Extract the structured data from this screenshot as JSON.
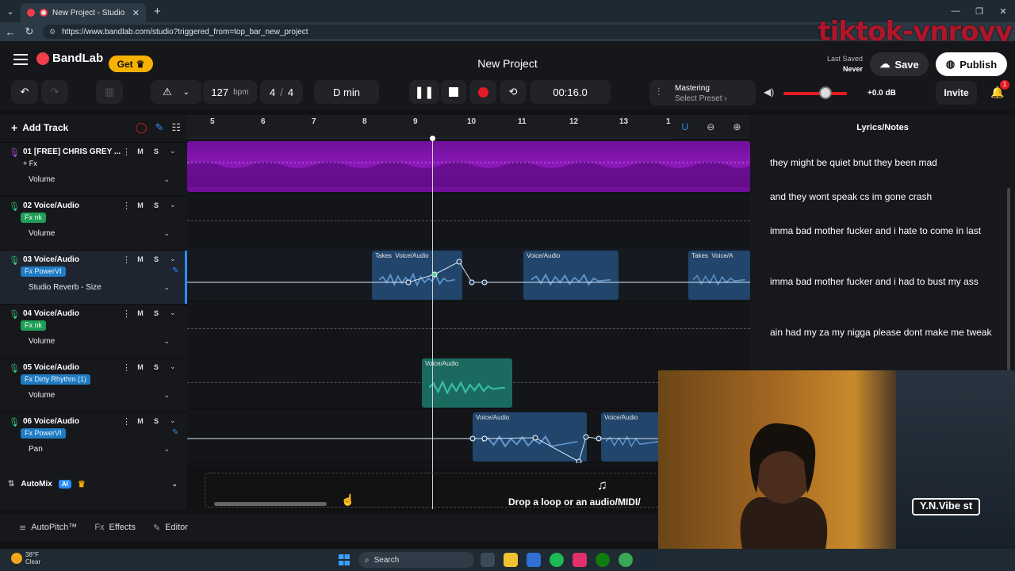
{
  "browser": {
    "tab1_title": "New Project - Studio",
    "url": "https://www.bandlab.com/studio?triggered_from=top_bar_new_project",
    "watermark": "tiktok-ynroyy"
  },
  "header": {
    "brand": "BandLab",
    "get_label": "Get",
    "project_title": "New Project",
    "last_saved_label": "Last Saved",
    "last_saved_value": "Never",
    "save_label": "Save",
    "publish_label": "Publish"
  },
  "toolbar": {
    "tempo": "127",
    "tempo_unit": "bpm",
    "time_sig_num": "4",
    "time_sig_sep": "/",
    "time_sig_den": "4",
    "key": "D min",
    "time": "00:16.0",
    "mastering_label": "Mastering",
    "mastering_preset": "Select Preset ›",
    "db_value": "+0.0 dB",
    "master_volume_fraction": 0.7,
    "invite_label": "Invite",
    "notification_count": "1"
  },
  "track_panel": {
    "add_track_label": "Add Track",
    "tracks": [
      {
        "name": "01  [FREE] CHRIS GREY ...",
        "fx": "+ Fx",
        "fx_style": "plain",
        "automation": "Volume"
      },
      {
        "name": "02  Voice/Audio",
        "fx": "Fx nk",
        "fx_style": "green",
        "automation": "Volume"
      },
      {
        "name": "03  Voice/Audio",
        "fx": "Fx PowerVI",
        "fx_style": "blue",
        "automation": "Studio Reverb - Size"
      },
      {
        "name": "04  Voice/Audio",
        "fx": "Fx nk",
        "fx_style": "green",
        "automation": "Volume"
      },
      {
        "name": "05  Voice/Audio",
        "fx": "Fx Dirty Rhythm (1)",
        "fx_style": "blue",
        "automation": "Volume"
      },
      {
        "name": "06  Voice/Audio",
        "fx": "Fx PowerVI",
        "fx_style": "blue",
        "automation": "Pan"
      }
    ],
    "mute_label": "M",
    "solo_label": "S",
    "automix_label": "AutoMix",
    "ai_badge": "AI"
  },
  "ruler": {
    "bars": [
      "5",
      "6",
      "7",
      "8",
      "9",
      "10",
      "11",
      "12",
      "13",
      "1"
    ]
  },
  "clips": {
    "voice_label": "Voice/Audio",
    "takes_label": "Takes",
    "takes_short": "Voice/A"
  },
  "drop": {
    "text": "Drop a loop or an audio/MIDI/"
  },
  "lyrics": {
    "title": "Lyrics/Notes",
    "lines": [
      "they might be quiet bnut they been mad",
      "and they wont speak cs im gone crash",
      "imma bad mother fucker and i hate to come in last",
      "imma bad mother fucker and i had to bust my ass",
      "ain had my za my nigga please dont make me tweak"
    ]
  },
  "webcam": {
    "neon_sign": "Y.N.Vibe st"
  },
  "bottom": {
    "autopitch": "AutoPitch™",
    "effects": "Effects",
    "editor": "Editor"
  },
  "taskbar": {
    "temp": "38°F",
    "weather": "Clear",
    "search": "Search"
  }
}
